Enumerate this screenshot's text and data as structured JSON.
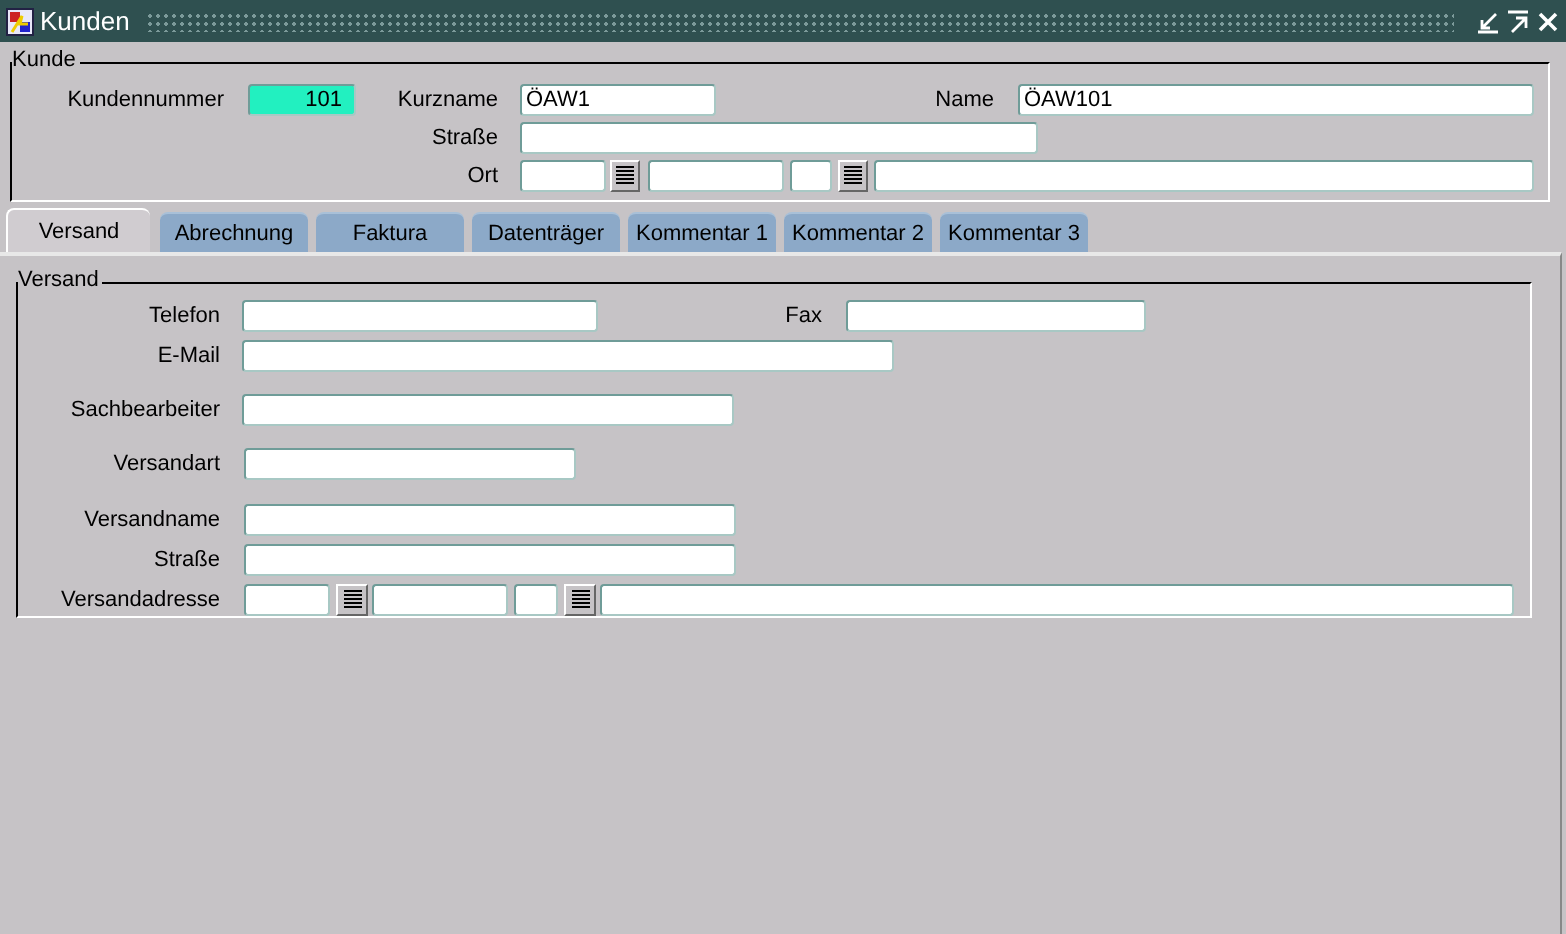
{
  "window": {
    "title": "Kunden"
  },
  "kunde": {
    "legend": "Kunde",
    "fields": [
      {
        "label": "Kundennummer",
        "value": "101",
        "highlighted": true
      },
      {
        "label": "Kurzname",
        "value": "ÖAW1",
        "highlighted": false
      },
      {
        "label": "Name",
        "value": "ÖAW101",
        "highlighted": false
      },
      {
        "label": "Straße",
        "highlighted": false
      },
      {
        "label": "Ort",
        "highlighted": false
      }
    ]
  },
  "tabs": [
    {
      "label": "Versand",
      "selected": true
    },
    {
      "label": "Abrechnung",
      "selected": false
    },
    {
      "label": "Faktura",
      "selected": false
    },
    {
      "label": "Datenträger",
      "selected": false
    },
    {
      "label": "Kommentar 1",
      "selected": false
    },
    {
      "label": "Kommentar 2",
      "selected": false
    },
    {
      "label": "Kommentar 3",
      "selected": false
    }
  ],
  "versand": {
    "legend": "Versand",
    "fields": [
      {
        "label": "Telefon"
      },
      {
        "label": "Fax"
      },
      {
        "label": "E-Mail"
      },
      {
        "label": "Sachbearbeiter"
      },
      {
        "label": "Versandart"
      },
      {
        "label": "Versandname"
      },
      {
        "label": "Straße"
      },
      {
        "label": "Versandadresse"
      }
    ]
  }
}
